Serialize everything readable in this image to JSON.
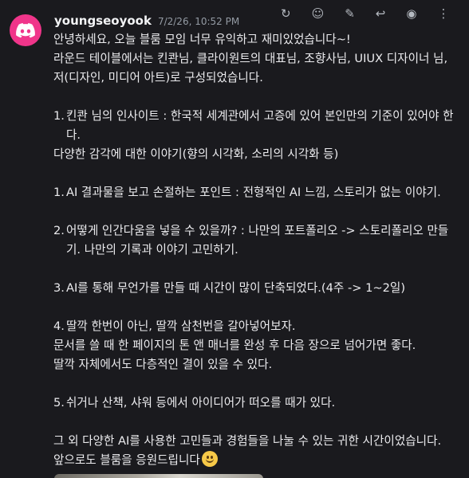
{
  "message": {
    "author": "youngseoyook",
    "timestamp": "7/2/26, 10:52 PM",
    "lines": {
      "l1": "안녕하세요, 오늘 블룸 모임 너무 유익하고 재미있었습니다~!",
      "l2": "라운드 테이블에서는 킨콴님, 클라이원트의 대표님, 조향사님, UIUX 디자이너 님,",
      "l3": "저(디자인, 미디어 아트)로 구성되었습니다.",
      "i1_num": "1.",
      "i1_text": "킨콴 님의 인사이트 : 한국적 세계관에서 고증에 있어 본인만의 기준이 있어야 한다.",
      "l4": "다양한 감각에 대한 이야기(향의 시각화, 소리의 시각화 등)",
      "i2_num": "1.",
      "i2_text": "AI 결과물을 보고 손절하는 포인트 : 전형적인 AI 느낌, 스토리가 없는 이야기.",
      "i3_num": "2.",
      "i3_text": "어떻게 인간다움을 넣을 수 있을까? : 나만의 포트폴리오 -> 스토리폴리오 만들기. 나만의 기록과 이야기 고민하기.",
      "i4_num": "3.",
      "i4_text": "AI를 통해 무언가를 만들 때 시간이 많이 단축되었다.(4주 -> 1~2일)",
      "i5_num": "4.",
      "i5_text": "딸깍 한번이 아닌, 딸깍 삼천번을 갈아넣어보자.",
      "l5": "문서를 쓸 때 한 페이지의 톤 앤 매너를 완성 후 다음 장으로 넘어가면 좋다.",
      "l6": "딸깍 자체에서도 다층적인 결이 있을 수 있다.",
      "i6_num": "5.",
      "i6_text": "쉬거나 산책, 샤워 등에서 아이디어가 떠오를 때가 있다.",
      "l7": "그 외 다양한 AI를 사용한 고민들과 경험들을 나눌 수 있는 귀한 시간이었습니다.",
      "l8": "앞으로도 블룸을 응원드립니다"
    }
  },
  "icons": {
    "avatar": "discord-logo-icon",
    "emoji": "slightly-smiling-face-emoji",
    "toolbar": [
      "refresh-icon",
      "react-icon",
      "edit-icon",
      "reply-icon",
      "forward-icon",
      "more-icon",
      "thread-icon",
      "flag-icon"
    ]
  },
  "colors": {
    "background": "#1a1a1e",
    "avatar": "#f0358a",
    "text": "#ececef",
    "timestamp": "#949ba4"
  }
}
